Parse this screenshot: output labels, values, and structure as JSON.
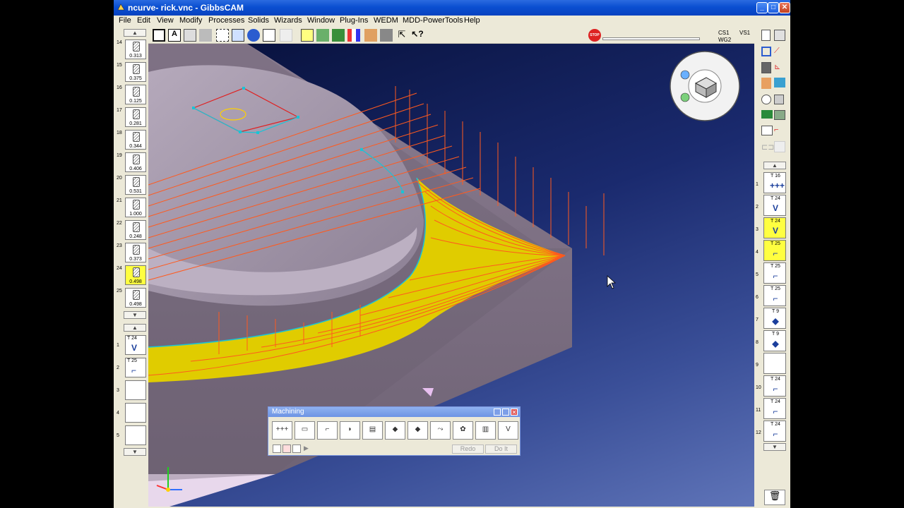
{
  "window": {
    "title": "ncurve- rick.vnc - GibbsCAM",
    "min": "_",
    "max": "□",
    "close": "✕"
  },
  "menu": [
    "File",
    "Edit",
    "View",
    "Modify",
    "Processes",
    "Solids",
    "Wizards",
    "Window",
    "Plug-Ins",
    "WEDM",
    "MDD-PowerTools",
    "Help"
  ],
  "status": {
    "cs": "CS1",
    "wg": "WG2",
    "vs": "VS1",
    "stop": "STOP"
  },
  "tools_left": [
    {
      "num": "14",
      "dia": "0.313"
    },
    {
      "num": "15",
      "dia": "0.375"
    },
    {
      "num": "16",
      "dia": "0.125"
    },
    {
      "num": "17",
      "dia": "0.281"
    },
    {
      "num": "18",
      "dia": "0.344"
    },
    {
      "num": "19",
      "dia": "0.406"
    },
    {
      "num": "20",
      "dia": "0.531"
    },
    {
      "num": "21",
      "dia": "1.000"
    },
    {
      "num": "22",
      "dia": "0.248"
    },
    {
      "num": "23",
      "dia": "0.373"
    },
    {
      "num": "24",
      "dia": "0.498",
      "selected": true
    },
    {
      "num": "25",
      "dia": "0.498"
    }
  ],
  "ops_left": [
    {
      "num": "1",
      "tool": "T 24",
      "icon": "V"
    },
    {
      "num": "2",
      "tool": "T 25",
      "icon": "⌐"
    },
    {
      "num": "3",
      "tool": "",
      "icon": ""
    },
    {
      "num": "4",
      "tool": "",
      "icon": ""
    },
    {
      "num": "5",
      "tool": "",
      "icon": ""
    }
  ],
  "ops_right": [
    {
      "num": "1",
      "tool": "T 16",
      "icon": "+++"
    },
    {
      "num": "2",
      "tool": "T 24",
      "icon": "V"
    },
    {
      "num": "3",
      "tool": "T 24",
      "icon": "V",
      "selected": true
    },
    {
      "num": "4",
      "tool": "T 25",
      "icon": "⌐",
      "selected": true
    },
    {
      "num": "5",
      "tool": "T 25",
      "icon": "⌐"
    },
    {
      "num": "6",
      "tool": "T 25",
      "icon": "⌐"
    },
    {
      "num": "7",
      "tool": "T 9",
      "icon": "◆"
    },
    {
      "num": "8",
      "tool": "T 9",
      "icon": "◆"
    },
    {
      "num": "9",
      "tool": "",
      "icon": ""
    },
    {
      "num": "10",
      "tool": "T 24",
      "icon": "⌐"
    },
    {
      "num": "11",
      "tool": "T 24",
      "icon": "⌐"
    },
    {
      "num": "12",
      "tool": "T 24",
      "icon": "⌐"
    }
  ],
  "machining": {
    "title": "Machining",
    "buttons": [
      "+++",
      "▭",
      "⌐",
      "◗",
      "▤",
      "◆",
      "◆",
      "⤳",
      "✿",
      "▥",
      "V"
    ],
    "redo": "Redo",
    "doit": "Do It"
  },
  "colors": {
    "accent": "#0a4fd1",
    "toolpath": "#ff5a1e",
    "stock": "#8c7d92",
    "highlight": "#ffff40"
  }
}
